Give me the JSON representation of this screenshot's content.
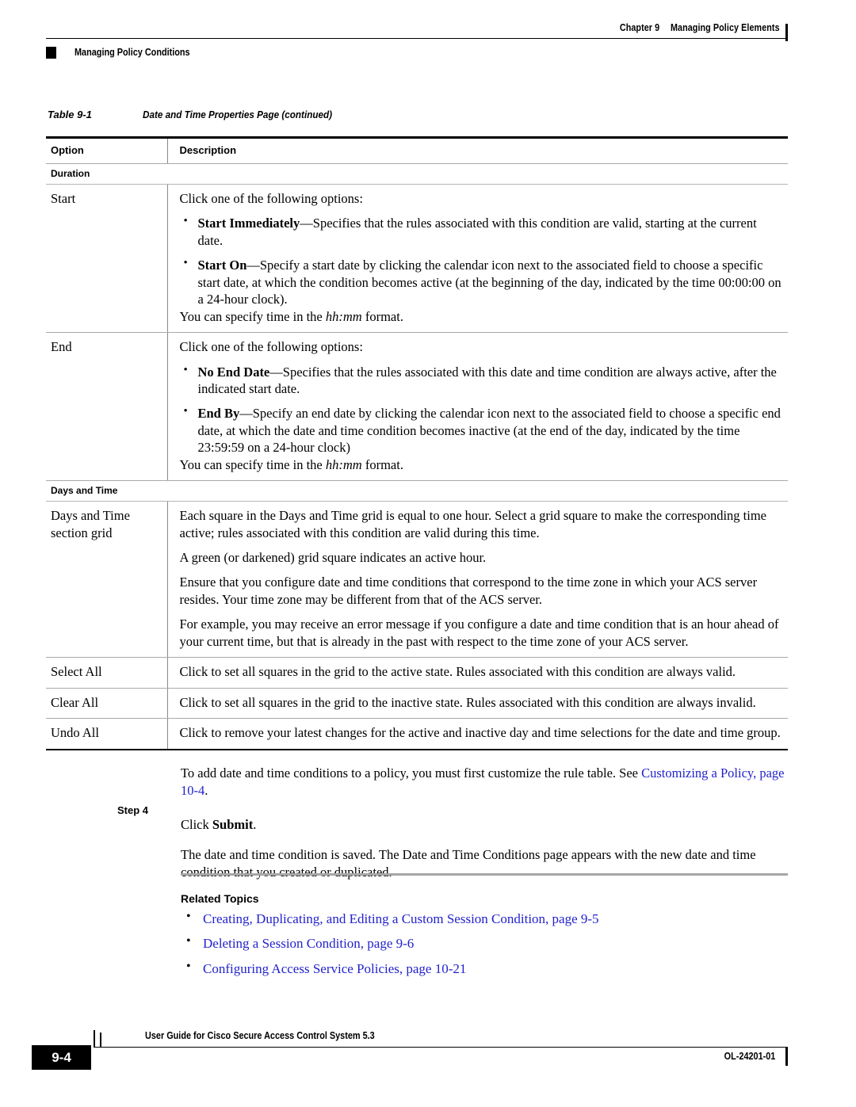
{
  "header": {
    "chapter": "Chapter 9",
    "chapter_title": "Managing Policy Elements",
    "section": "Managing Policy Conditions"
  },
  "table": {
    "caption_number": "Table 9-1",
    "caption_title": "Date and Time Properties Page (continued)",
    "columns": [
      "Option",
      "Description"
    ],
    "sections": [
      {
        "section_label": "Duration",
        "rows": [
          {
            "option": "Start",
            "intro": "Click one of the following options:",
            "bullets": [
              {
                "lead": "Start Immediately",
                "text": "—Specifies that the rules associated with this condition are valid, starting at the current date."
              },
              {
                "lead": "Start On",
                "text": "—Specify a start date by clicking the calendar icon next to the associated field to choose a specific start date, at which the condition becomes active (at the beginning of the day, indicated by the time 00:00:00 on a 24-hour clock)."
              }
            ],
            "outro_prefix": "You can specify time in the ",
            "outro_format": "hh:mm",
            "outro_suffix": " format."
          },
          {
            "option": "End",
            "intro": "Click one of the following options:",
            "bullets": [
              {
                "lead": "No End Date",
                "text": "—Specifies that the rules associated with this date and time condition are always active, after the indicated start date."
              },
              {
                "lead": "End By",
                "text": "—Specify an end date by clicking the calendar icon next to the associated field to choose a specific end date, at which the date and time condition becomes inactive (at the end of the day, indicated by the time 23:59:59 on a 24-hour clock)"
              }
            ],
            "outro_prefix": "You can specify time in the ",
            "outro_format": "hh:mm",
            "outro_suffix": " format."
          }
        ]
      },
      {
        "section_label": "Days and Time",
        "rows": [
          {
            "option": "Days and Time section grid",
            "paragraphs": [
              "Each square in the Days and Time grid is equal to one hour. Select a grid square to make the corresponding time active; rules associated with this condition are valid during this time.",
              "A green (or darkened) grid square indicates an active hour.",
              "Ensure that you configure date and time conditions that correspond to the time zone in which your ACS server resides. Your time zone may be different from that of the ACS server.",
              "For example, you may receive an error message if you configure a date and time condition that is an hour ahead of your current time, but that is already in the past with respect to the time zone of your ACS server."
            ]
          },
          {
            "option": "Select All",
            "paragraphs": [
              "Click to set all squares in the grid to the active state. Rules associated with this condition are always valid."
            ]
          },
          {
            "option": "Clear All",
            "paragraphs": [
              "Click to set all squares in the grid to the inactive state. Rules associated with this condition are always invalid."
            ]
          },
          {
            "option": "Undo All",
            "paragraphs": [
              "Click to remove your latest changes for the active and inactive day and time selections for the date and time group."
            ]
          }
        ]
      }
    ]
  },
  "post_table": {
    "intro_text": "To add date and time conditions to a policy, you must first customize the rule table. See ",
    "intro_link": "Customizing a Policy, page 10-4",
    "intro_period": "."
  },
  "step": {
    "label": "Step 4",
    "text_before": "Click ",
    "bold_text": "Submit",
    "text_after": ".",
    "result": "The date and time condition is saved. The Date and Time Conditions page appears with the new date and time condition that you created or duplicated."
  },
  "related_topics": {
    "title": "Related Topics",
    "links": [
      "Creating, Duplicating, and Editing a Custom Session Condition, page 9-5",
      "Deleting a Session Condition, page 9-6",
      "Configuring Access Service Policies, page 10-21"
    ]
  },
  "footer": {
    "page_number": "9-4",
    "guide_title": "User Guide for Cisco Secure Access Control System 5.3",
    "doc_id": "OL-24201-01"
  },
  "colors": {
    "link": "#2222cc",
    "rule_dark": "#000000",
    "rule_light": "#a9a9a9"
  }
}
